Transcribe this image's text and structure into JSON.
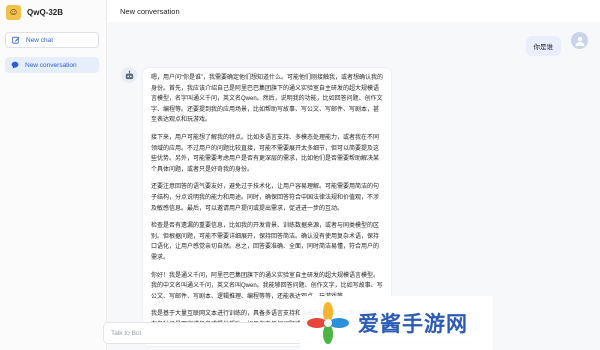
{
  "app": {
    "name": "QwQ-32B",
    "logo_glyph": "☺"
  },
  "sidebar": {
    "new_chat_label": "New chat",
    "conversation_label": "New conversation"
  },
  "header": {
    "title": "New conversation"
  },
  "user_message": {
    "text": "你是谁"
  },
  "bot_message": {
    "paragraphs": [
      "嗯，用户问“你是谁”，我需要确定他们想知道什么。可能他们刚接触我，或者想确认我的身份。首先，我应该介绍自己是阿里巴巴集团旗下的通义实验室自主研发的超大规模语言模型，名字叫通义千问，英文名Qwen。然后，说明我的功能，比如回答问题、创作文字、编程等。还要提到我的应用场景，比如帮助写故事、写公文、写邮件、写剧本，甚至表达观点和玩游戏。",
      "接下来，用户可能想了解我的特点。比如多语言支持、多模态处理能力，或者我在不同领域的应用。不过用户的问题比较直接，可能不需要展开太多细节，但可以简要提及这些优势。另外，可能需要考虑用户是否有更深层的需求，比如他们是否需要帮助解决某个具体问题，或者只是好奇我的身份。",
      "还要注意回答的语气要友好，避免过于技术化，让用户容易理解。可能需要用简洁的句子结构，分点说明我的能力和用途。同时，确保回答符合中国法律法规和价值观，不涉及敏感信息。最后，可以邀请用户提问或提出需求，促进进一步的互动。",
      "检查是否有遗漏的重要信息，比如我的开发背景、训练数据来源，或者与同类模型的区别。但根据问题，可能不需要详细展开，保持回答简洁。确认没有使用复杂术语，保持口语化，让用户感觉亲切自然。总之，回答要准确、全面，同时简洁易懂，符合用户的需求。",
      "你好！我是通义千问，阿里巴巴集团旗下的通义实验室自主研发的超大规模语言模型。我的中文名叫通义千问，英文名叫Qwen。我能够回答问题、创作文字，比如写故事、写公文、写邮件、写剧本、逻辑推理、编程等等，还能表达观点，玩游戏等。",
      "我是基于大量互联网文本进行训练的，具备多语言支持和多模态处理能力，可以辅助你在各种场景下完成任务或提供帮助。如果你有任何问题或需要帮助的地方，随时告诉我！😊"
    ]
  },
  "input": {
    "placeholder": "Talk to Bot",
    "value": ""
  },
  "watermark": {
    "text": "爱酱手游网"
  },
  "colors": {
    "accent": "#2b5fd9",
    "user_bubble": "#e9eefc",
    "brand_logo": "#f2c14e",
    "watermark_text": "#2b5bb5"
  }
}
